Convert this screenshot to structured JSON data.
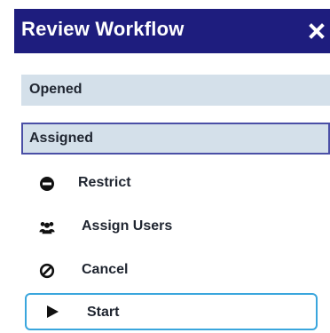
{
  "header": {
    "title": "Review Workflow",
    "background": "#1e1d7e",
    "close_icon": "close-icon"
  },
  "states": [
    {
      "label": "Opened",
      "selected": false
    },
    {
      "label": "Assigned",
      "selected": true
    }
  ],
  "actions": [
    {
      "label": "Restrict",
      "icon": "minus-circle-icon"
    },
    {
      "label": "Assign Users",
      "icon": "users-icon"
    },
    {
      "label": "Cancel",
      "icon": "ban-icon"
    },
    {
      "label": "Start",
      "icon": "play-icon",
      "focused": true
    }
  ],
  "colors": {
    "header_bg": "#1e1d7e",
    "state_bg": "#d4e0ea",
    "selected_border": "#4a4fa6",
    "focus_border": "#3aa6dd"
  }
}
